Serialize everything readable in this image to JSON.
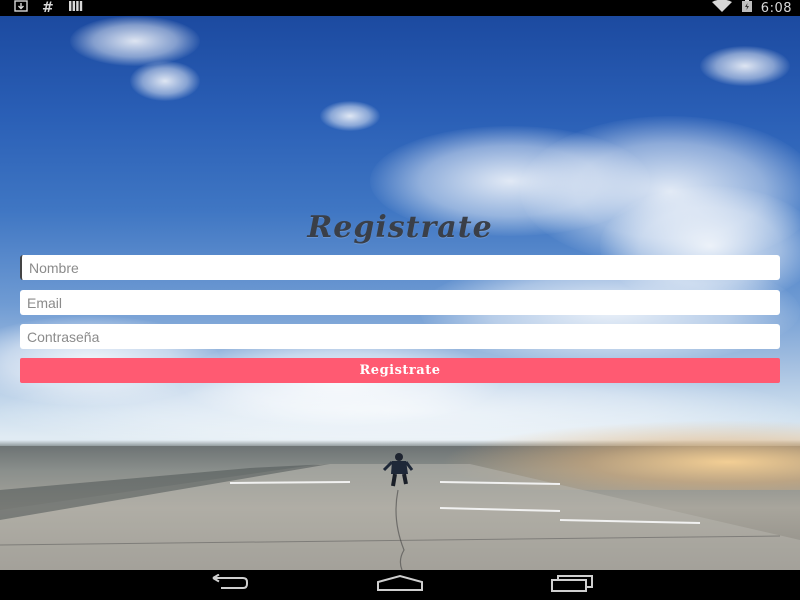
{
  "status_bar": {
    "clock": "6:08",
    "left_icons": [
      "download-icon",
      "hash-icon",
      "signal-bars-icon"
    ],
    "hash_glyph": "#",
    "right_icons": [
      "wifi-icon",
      "battery-icon"
    ]
  },
  "form": {
    "title": "Registrate",
    "name_placeholder": "Nombre",
    "email_placeholder": "Email",
    "password_placeholder": "Contraseña",
    "submit_label": "Registrate"
  },
  "colors": {
    "accent": "#ff5a72",
    "title": "#3a3f48"
  },
  "nav_bar": {
    "icons": [
      "back-icon",
      "home-icon",
      "recents-icon"
    ]
  }
}
